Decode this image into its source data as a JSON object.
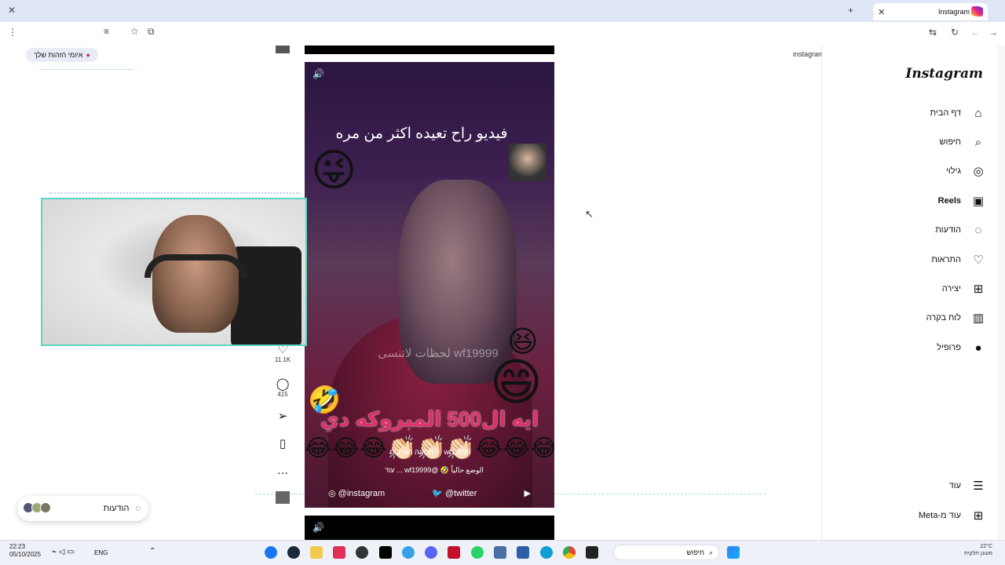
{
  "browser": {
    "tab_title": "Instagram",
    "url": "instagram.com/reels/DPEfHBPCLY/",
    "privacy_chip": "איומי הזהות שלך"
  },
  "instagram": {
    "logo": "Instagram",
    "nav": [
      {
        "label": "דף הבית",
        "icon": "home-icon",
        "glyph": "⌂"
      },
      {
        "label": "חיפוש",
        "icon": "search-icon",
        "glyph": "⌕"
      },
      {
        "label": "גילוי",
        "icon": "compass-icon",
        "glyph": "◎"
      },
      {
        "label": "Reels",
        "icon": "reels-icon",
        "glyph": "▣"
      },
      {
        "label": "הודעות",
        "icon": "messenger-icon",
        "glyph": "◌"
      },
      {
        "label": "התראות",
        "icon": "heart-icon",
        "glyph": "♡"
      },
      {
        "label": "יצירה",
        "icon": "plus-icon",
        "glyph": "⊞"
      },
      {
        "label": "לוח בקרה",
        "icon": "dashboard-icon",
        "glyph": "▥"
      },
      {
        "label": "פרופיל",
        "icon": "profile-avatar-icon",
        "glyph": "●"
      }
    ],
    "more": "עוד",
    "more_meta": "עוד מ-Meta",
    "messages_pill": "הודעות"
  },
  "reel": {
    "caption_top": "فيديو راح تعيده اكثر من مره",
    "watermark": "wf19999 لحظات لاتنسى",
    "caption_bottom": "ايه ال500 المبروكه دي",
    "music_line": "wf19999 · החתונה הערבית",
    "credit_line": "الوضع حالياً 🤣 @wf19999 ... עוד",
    "social_instagram": "@instagram",
    "social_twitter": "@twitter",
    "likes": "11.1K",
    "comments": "415"
  },
  "taskbar": {
    "time": "22:23",
    "date": "05/10/2025",
    "lang": "ENG",
    "search_placeholder": "חיפוש",
    "temp": "22°C",
    "weather": "מעונן חלקית"
  }
}
